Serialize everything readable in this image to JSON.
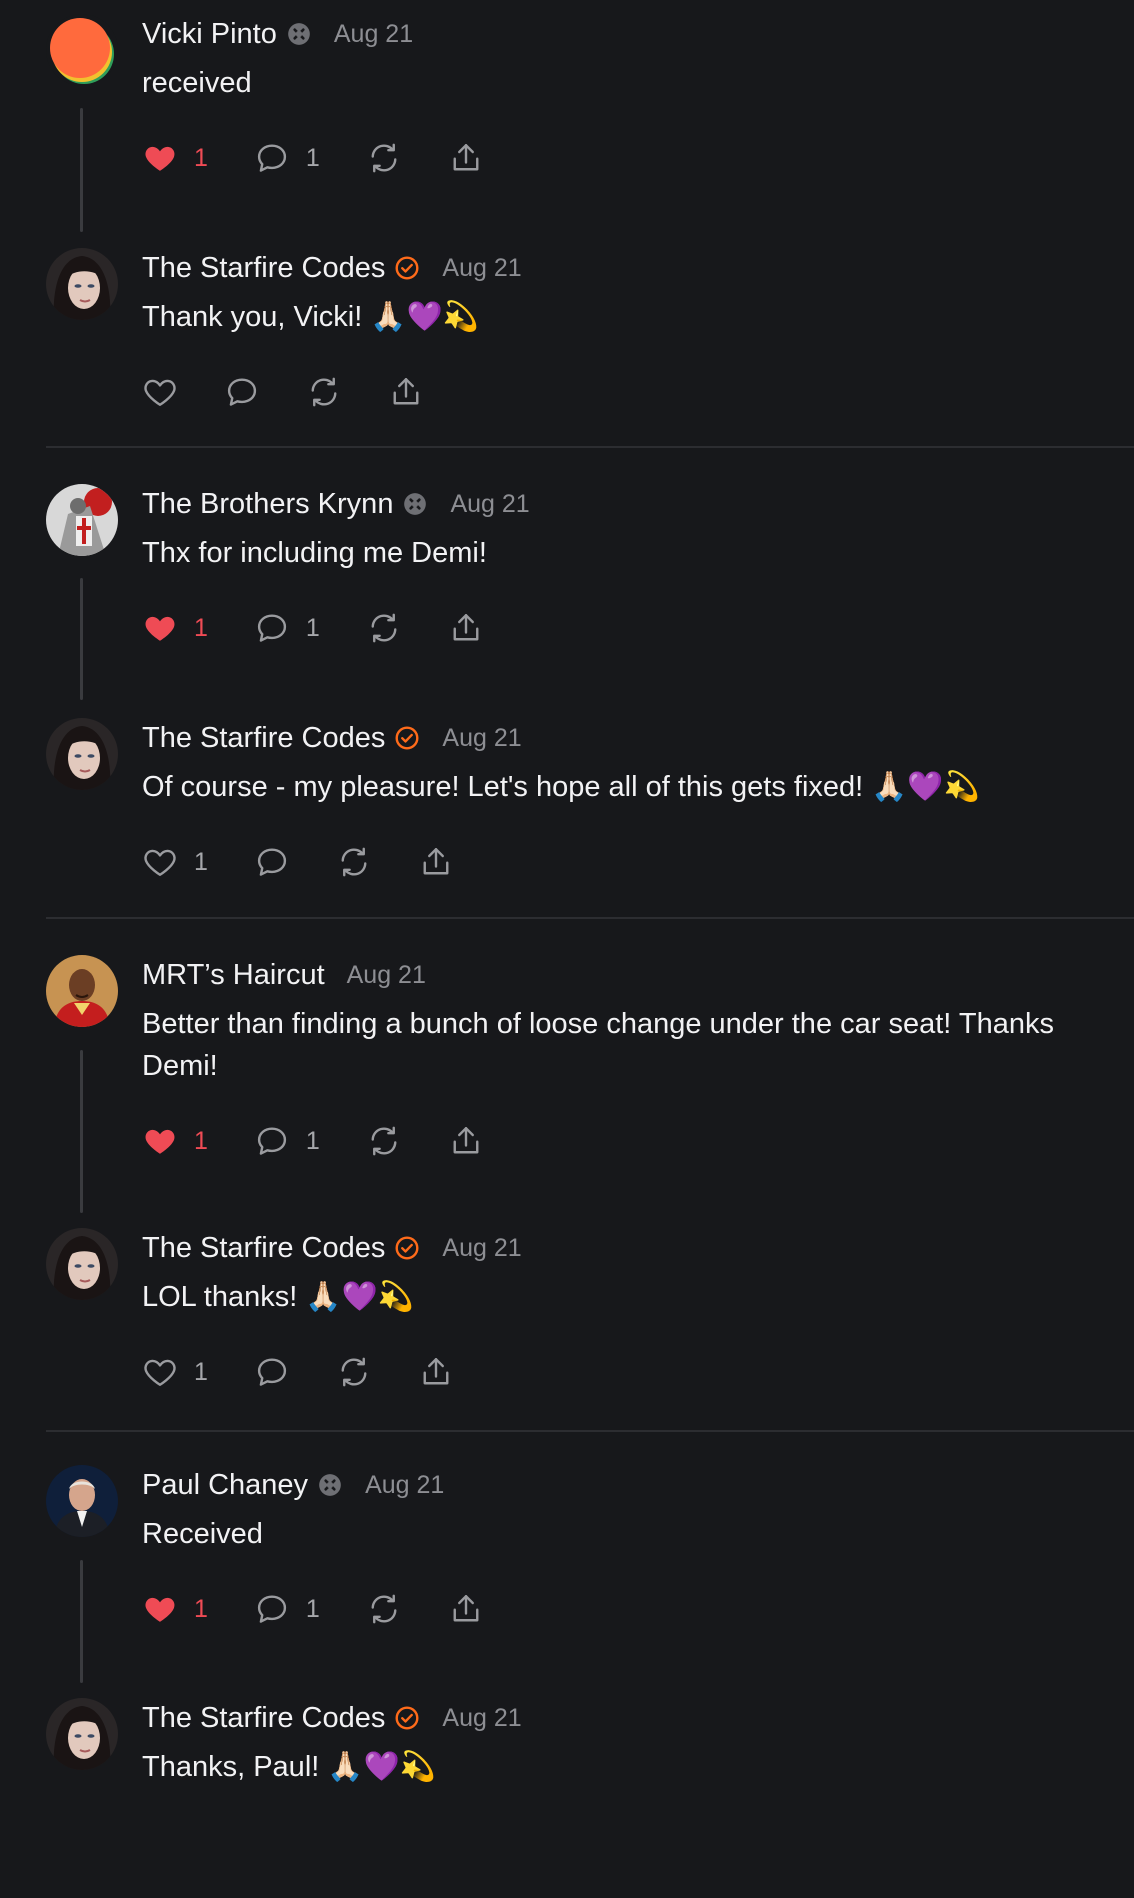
{
  "posts": [
    {
      "author": "Vicki Pinto",
      "badge": "affiliate",
      "date": "Aug 21",
      "text": "received",
      "likes": "1",
      "liked": true,
      "replies": "1"
    },
    {
      "author": "The Starfire Codes",
      "badge": "verified",
      "date": "Aug 21",
      "text": "Thank you, Vicki! 🙏🏻💜💫",
      "likes": "",
      "liked": false,
      "replies": ""
    },
    {
      "author": "The Brothers Krynn",
      "badge": "affiliate",
      "date": "Aug 21",
      "text": "Thx for including me Demi!",
      "likes": "1",
      "liked": true,
      "replies": "1"
    },
    {
      "author": "The Starfire Codes",
      "badge": "verified",
      "date": "Aug 21",
      "text": "Of course - my pleasure! Let's hope all of this gets fixed! 🙏🏻💜💫",
      "likes": "1",
      "liked": false,
      "replies": ""
    },
    {
      "author": "MRT’s Haircut",
      "badge": "none",
      "date": "Aug 21",
      "text": "Better than finding a bunch of loose change under the car seat! Thanks Demi!",
      "likes": "1",
      "liked": true,
      "replies": "1"
    },
    {
      "author": "The Starfire Codes",
      "badge": "verified",
      "date": "Aug 21",
      "text": "LOL thanks! 🙏🏻💜💫",
      "likes": "1",
      "liked": false,
      "replies": ""
    },
    {
      "author": "Paul Chaney",
      "badge": "affiliate",
      "date": "Aug 21",
      "text": "Received",
      "likes": "1",
      "liked": true,
      "replies": "1"
    },
    {
      "author": "The Starfire Codes",
      "badge": "verified",
      "date": "Aug 21",
      "text": "Thanks, Paul! 🙏🏻💜💫",
      "likes": "",
      "liked": false,
      "replies": ""
    }
  ],
  "colors": {
    "background": "#17181b",
    "like_active": "#ef4b55",
    "verified_badge": "#ff6b1a",
    "muted_text": "#8d8e93"
  }
}
